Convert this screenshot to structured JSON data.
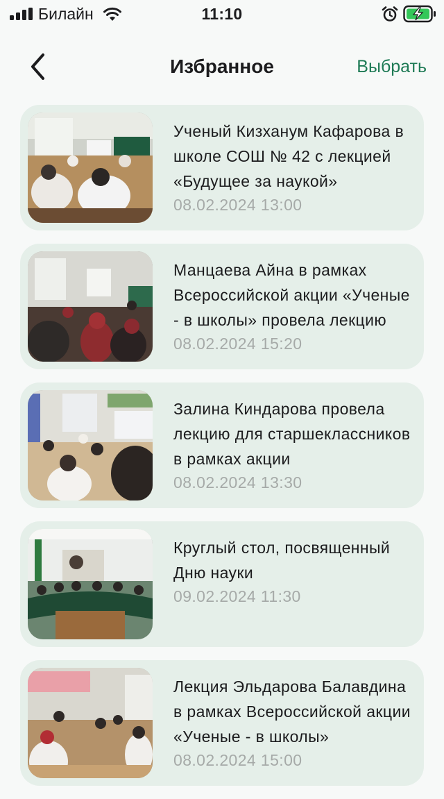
{
  "status_bar": {
    "carrier": "Билайн",
    "time": "11:10",
    "icons": [
      "signal-icon",
      "wifi-icon",
      "alarm-icon",
      "battery-charging-icon"
    ]
  },
  "nav": {
    "back_icon": "chevron-left-icon",
    "title": "Избранное",
    "select_label": "Выбрать"
  },
  "colors": {
    "accent": "#1e7a55",
    "card_bg": "#e5efe9",
    "date_text": "#a6aaa8",
    "background": "#f7f9f8"
  },
  "items": [
    {
      "title": "Ученый Кизханум Кафарова в школе СОШ № 42 с лекцией «Будущее за наукой»",
      "date": "08.02.2024 13:00",
      "photo": "classroom-photo"
    },
    {
      "title": "Манцаева Айна в рамках Всероссийской акции «Ученые - в школы» провела лекцию",
      "date": "08.02.2024 15:20",
      "photo": "classroom-photo"
    },
    {
      "title": "Залина Киндарова провела лекцию для старшеклассников в рамках акции",
      "date": "08.02.2024 13:30",
      "photo": "classroom-photo"
    },
    {
      "title": "Круглый стол, посвященный Дню науки",
      "date": "09.02.2024 11:30",
      "photo": "roundtable-photo"
    },
    {
      "title": "Лекция Эльдарова Балавдина в рамках Всероссийской акции «Ученые - в школы»",
      "date": "08.02.2024 15:00",
      "photo": "classroom-photo"
    }
  ]
}
